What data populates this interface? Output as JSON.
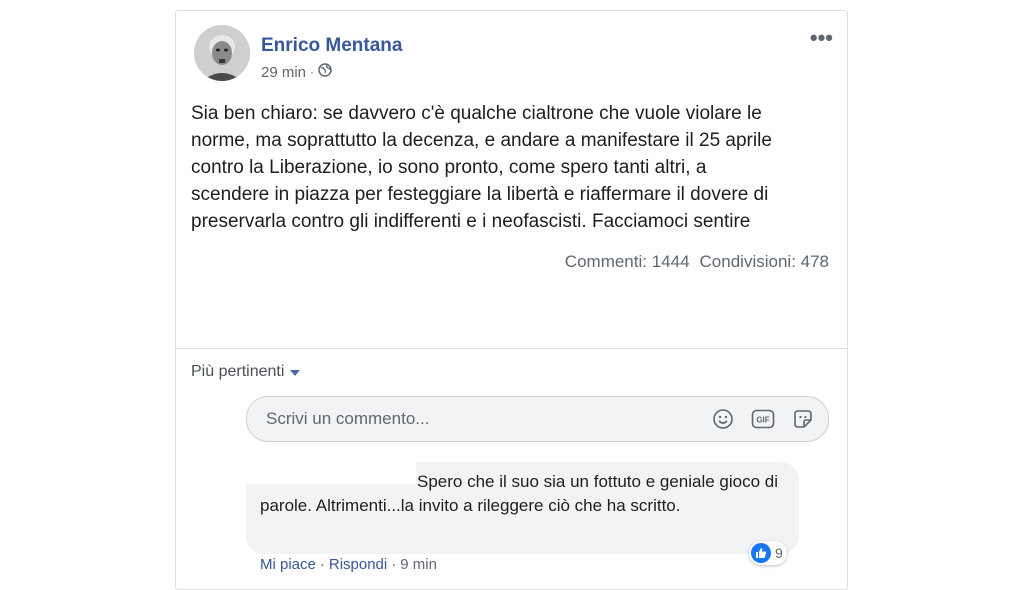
{
  "post": {
    "author": "Enrico Mentana",
    "time": "29 min",
    "separator": "·",
    "more_label": "•••",
    "text": "Sia ben chiaro: se davvero c'è qualche cialtrone che vuole violare le\nnorme, ma soprattutto la decenza, e andare a manifestare il 25 aprile\ncontro la Liberazione, io sono pronto, come spero tanti altri, a\nscendere in piazza per festeggiare la libertà e riaffermare il dovere di\npreservarla contro gli indifferenti e i neofascisti. Facciamoci sentire",
    "comments_stat": "Commenti: 1444",
    "shares_stat": "Condivisioni: 478"
  },
  "comments": {
    "sort_label": "Più pertinenti",
    "input_placeholder": "Scrivi un commento...",
    "icons": [
      "emoji-icon",
      "gif-icon",
      "sticker-icon"
    ]
  },
  "reply": {
    "text": "Spero che il suo sia un fottuto e geniale gioco di parole. Altrimenti...la invito a rileggere ciò che ha scritto.",
    "like_label": "Mi piace",
    "reply_label": "Rispondi",
    "time": "9 min",
    "like_count": "9",
    "like_icon": "thumbs-up-icon"
  },
  "colors": {
    "link": "#385898",
    "like_blue": "#1877f2",
    "muted": "#606770"
  }
}
